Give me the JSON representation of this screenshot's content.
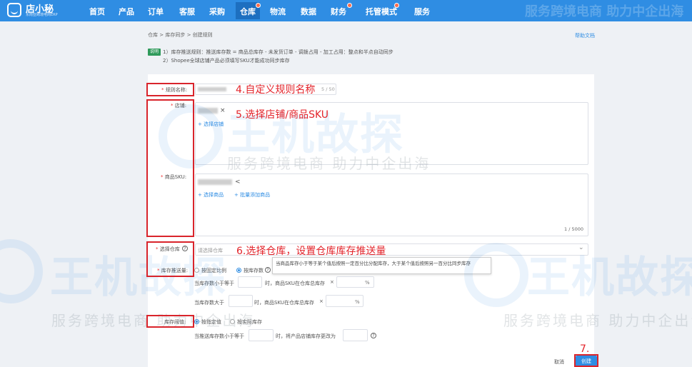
{
  "app": {
    "name": "店小秘",
    "subtitle": "东南亚跨境电商ERP"
  },
  "nav": [
    {
      "label": "首页",
      "dot": false
    },
    {
      "label": "产品",
      "dot": false
    },
    {
      "label": "订单",
      "dot": false
    },
    {
      "label": "客服",
      "dot": false
    },
    {
      "label": "采购",
      "dot": false
    },
    {
      "label": "仓库",
      "dot": true,
      "active": true
    },
    {
      "label": "物流",
      "dot": false
    },
    {
      "label": "数据",
      "dot": false
    },
    {
      "label": "财务",
      "dot": true
    },
    {
      "label": "托管模式",
      "dot": true
    },
    {
      "label": "服务",
      "dot": false
    }
  ],
  "watermark": {
    "slogan": "服务跨境电商 助力中企出海",
    "brand": "王机故探"
  },
  "breadcrumb": {
    "root": "仓库",
    "parent": "库存同步",
    "current": "创建规则",
    "sep": ">"
  },
  "help_label": "帮助文档",
  "notice": {
    "tag": "说明",
    "line1": "1）库存推送规则：推送库存数 = 商品总库存 - 未发货订单 - 调拨占用 - 加工占用：整点和半点自动同步",
    "line2": "2）Shopee全球店铺产品必须填写SKU才能成功同步库存"
  },
  "form": {
    "rule_name": {
      "label": "规则名称:",
      "counter": "5 / 50"
    },
    "shop": {
      "label": "店铺:",
      "add_link": "+ 选择店铺",
      "remove": "×"
    },
    "sku": {
      "label": "商品SKU:",
      "add_link": "+ 选择商品",
      "batch_link": "+ 批量添加商品",
      "counter": "1 / 5000",
      "collapse": "<"
    },
    "warehouse": {
      "label": "选择仓库",
      "placeholder": "请选择仓库",
      "help": "?",
      "arrow": "⌄"
    },
    "push_qty": {
      "label": "库存推送量:",
      "option1": "按固定比例",
      "option2": "按库存数",
      "help": "?",
      "tooltip": "当商品库存小于等于某个值后按照一定百分比分配库存，大于某个值后按照另一百分比同步库存",
      "row1_prefix": "当库存数小于等于",
      "row1_mid": "时，商品SKU在仓库总库存",
      "row2_prefix": "当库存数大于",
      "row2_mid": "时，商品SKU在仓库总库存",
      "times": "×",
      "unit": "%"
    },
    "threshold": {
      "label": "库存阈值:",
      "option1": "按指定值",
      "option2": "按实际库存",
      "row_prefix": "当推送库存数小于等于",
      "row_mid": "时，将产品店铺库存更改为",
      "help": "?"
    }
  },
  "buttons": {
    "cancel": "取消",
    "create": "创建"
  },
  "annotations": {
    "a4": "4.自定义规则名称",
    "a5": "5.选择店铺/商品SKU",
    "a6": "6.选择仓库，设置仓库库存推送量",
    "a7": "7."
  }
}
